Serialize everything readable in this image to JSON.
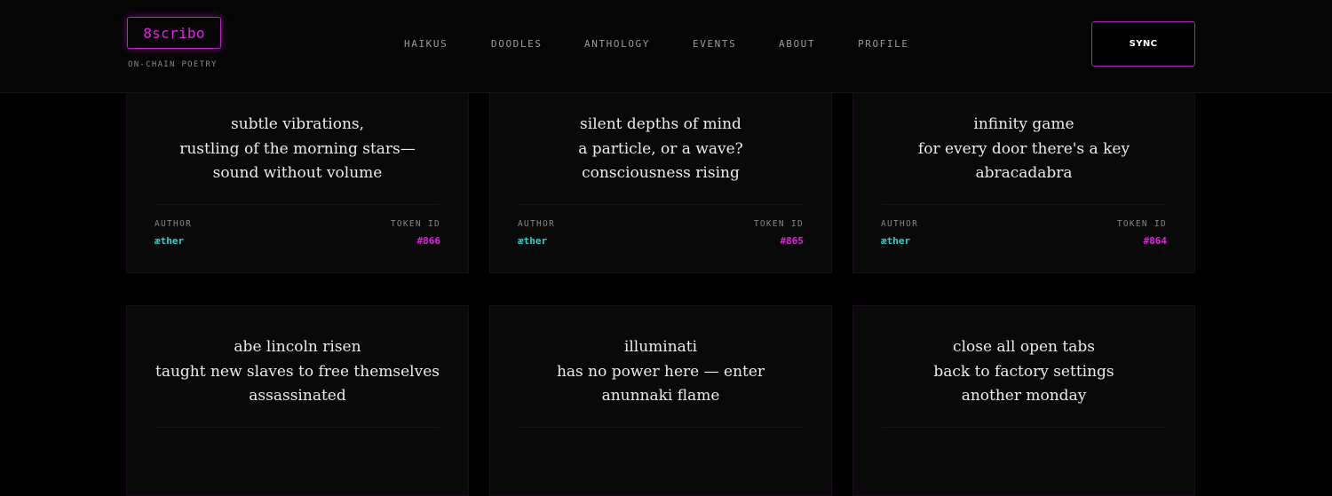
{
  "brand": {
    "logo": "8scribo",
    "tagline": "ON-CHAIN POETRY",
    "accent": "#e024e6"
  },
  "nav": {
    "items": [
      {
        "label": "HAIKUS"
      },
      {
        "label": "DOODLES"
      },
      {
        "label": "ANTHOLOGY"
      },
      {
        "label": "EVENTS"
      },
      {
        "label": "ABOUT"
      },
      {
        "label": "PROFILE"
      }
    ]
  },
  "sync": {
    "label": "SYNC"
  },
  "cards": [
    {
      "lines": [
        "subtle vibrations,",
        "rustling of the morning stars—",
        "sound without volume"
      ],
      "author_label": "AUTHOR",
      "author": "æther",
      "token_label": "TOKEN ID",
      "token": "#866"
    },
    {
      "lines": [
        "silent depths of mind",
        "a particle, or a wave?",
        "consciousness rising"
      ],
      "author_label": "AUTHOR",
      "author": "æther",
      "token_label": "TOKEN ID",
      "token": "#865"
    },
    {
      "lines": [
        "infinity game",
        "for every door there's a key",
        "abracadabra"
      ],
      "author_label": "AUTHOR",
      "author": "æther",
      "token_label": "TOKEN ID",
      "token": "#864"
    },
    {
      "lines": [
        "abe lincoln risen",
        "taught new slaves to free themselves",
        "assassinated"
      ]
    },
    {
      "lines": [
        "illuminati",
        "has no power here — enter",
        "anunnaki flame"
      ]
    },
    {
      "lines": [
        "close all open tabs",
        "back to factory settings",
        "another monday"
      ]
    }
  ],
  "colors": {
    "background": "#000000",
    "author": "#2ad2d2",
    "token": "#e020e0"
  }
}
